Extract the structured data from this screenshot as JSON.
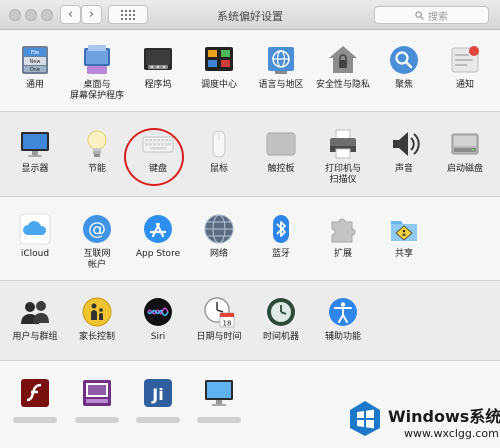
{
  "window": {
    "title": "系统偏好设置",
    "search_placeholder": "搜索"
  },
  "rows": {
    "personal": [
      "通用",
      "桌面与\n屏幕保护程序",
      "程序坞",
      "调度中心",
      "语言与地区",
      "安全性与隐私",
      "聚焦",
      "通知"
    ],
    "hardware": [
      "显示器",
      "节能",
      "键盘",
      "鼠标",
      "触控板",
      "打印机与\n扫描仪",
      "声音",
      "启动磁盘"
    ],
    "internet": [
      "iCloud",
      "互联网\n帐户",
      "App Store",
      "网络",
      "蓝牙",
      "扩展",
      "共享"
    ],
    "system": [
      "用户与群组",
      "家长控制",
      "Siri",
      "日期与时间",
      "时间机器",
      "辅助功能"
    ]
  },
  "icons": {
    "general_file_label": "File",
    "general_new_label": "New",
    "general_one_label": "One",
    "calendar_day": "18"
  },
  "watermark": {
    "title": "Windows系统城",
    "url": "www.wxclgg.com"
  },
  "highlight_color": "#d91e1e"
}
